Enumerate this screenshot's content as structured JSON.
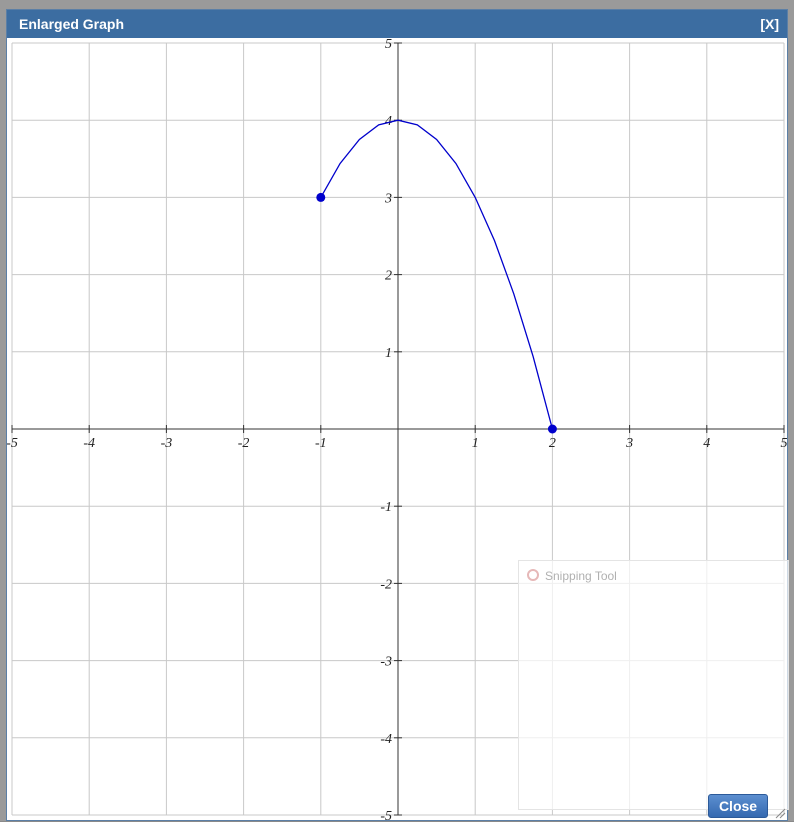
{
  "dialog": {
    "title": "Enlarged Graph",
    "close_x_label": "[X]",
    "close_button_label": "Close"
  },
  "overlay": {
    "snipping_tool_title": "Snipping Tool"
  },
  "colors": {
    "titlebar": "#3c6da1",
    "curve": "#0000cc",
    "grid": "#c8c8c8",
    "axis": "#333333"
  },
  "chart_data": {
    "type": "line",
    "xlim": [
      -5,
      5
    ],
    "ylim": [
      -5,
      5
    ],
    "x_ticks": [
      -5,
      -4,
      -3,
      -2,
      -1,
      1,
      2,
      3,
      4,
      5
    ],
    "y_ticks": [
      -5,
      -4,
      -3,
      -2,
      -1,
      1,
      2,
      3,
      4,
      5
    ],
    "grid": true,
    "series": [
      {
        "x": [
          -1,
          -0.75,
          -0.5,
          -0.25,
          0,
          0.25,
          0.5,
          0.75,
          1,
          1.25,
          1.5,
          1.75,
          2
        ],
        "y": [
          3,
          3.44,
          3.75,
          3.94,
          4,
          3.94,
          3.75,
          3.44,
          3,
          2.44,
          1.75,
          0.94,
          0
        ]
      }
    ],
    "points": [
      {
        "x": -1,
        "y": 3
      },
      {
        "x": 2,
        "y": 0
      }
    ]
  }
}
